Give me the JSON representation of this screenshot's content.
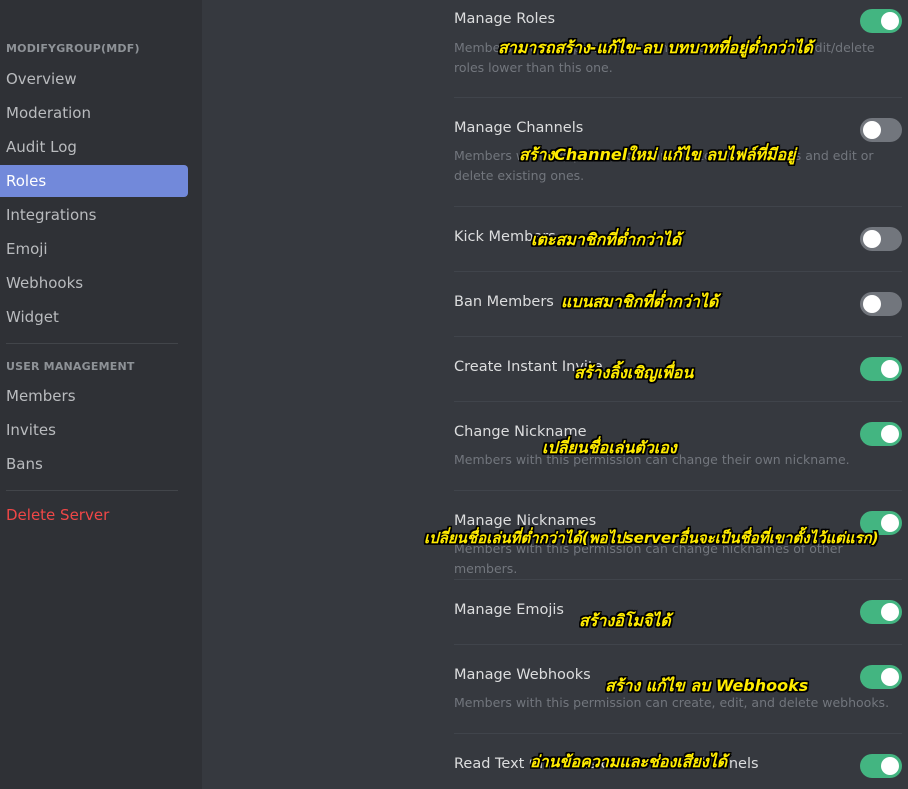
{
  "sidebar": {
    "server_header": "MODIFYGROUP(MDF)",
    "server_items": [
      {
        "label": "Overview"
      },
      {
        "label": "Moderation"
      },
      {
        "label": "Audit Log"
      },
      {
        "label": "Roles"
      },
      {
        "label": "Integrations"
      },
      {
        "label": "Emoji"
      },
      {
        "label": "Webhooks"
      },
      {
        "label": "Widget"
      }
    ],
    "user_header": "USER MANAGEMENT",
    "user_items": [
      {
        "label": "Members"
      },
      {
        "label": "Invites"
      },
      {
        "label": "Bans"
      }
    ],
    "delete_label": "Delete Server",
    "active_item": "Roles"
  },
  "permissions": [
    {
      "title": "Manage Roles",
      "desc": "Members with this permission can create new roles and edit/delete roles lower than this one.",
      "enabled": true,
      "annotation": "สามารถสร้าง-แก้ไข-ลบ บทบาทที่อยู่ต่ำกว่าได้"
    },
    {
      "title": "Manage Channels",
      "desc": "Members with this permission can create new channels and edit or delete existing ones.",
      "enabled": false,
      "annotation": "สร้างChannelใหม่ แก้ไข ลบไฟล์ที่มีอยู่"
    },
    {
      "title": "Kick Members",
      "desc": "",
      "enabled": false,
      "annotation": "เตะสมาชิกที่ต่ำกว่าได้"
    },
    {
      "title": "Ban Members",
      "desc": "",
      "enabled": false,
      "annotation": "แบนสมาชิกที่ต่ำกว่าได้"
    },
    {
      "title": "Create Instant Invite",
      "desc": "",
      "enabled": true,
      "annotation": "สร้างลิ้งเชิญเพื่อน"
    },
    {
      "title": "Change Nickname",
      "desc": "Members with this permission can change their own nickname.",
      "enabled": true,
      "annotation": "เปลี่ยนชื่อเล่นตัวเอง"
    },
    {
      "title": "Manage Nicknames",
      "desc": "Members with this permission can change nicknames of other members.",
      "enabled": true,
      "annotation": "เปลี่ยนชื่อเล่นที่ต่ำกว่าได้(พอไปserverอื่นจะเป็นชื่อที่เขาตั้งไว้แต่แรก)"
    },
    {
      "title": "Manage Emojis",
      "desc": "",
      "enabled": true,
      "annotation": "สร้างอิโมจิได้"
    },
    {
      "title": "Manage Webhooks",
      "desc": "Members with this permission can create, edit, and delete webhooks.",
      "enabled": true,
      "annotation": "สร้าง แก้ไข ลบ Webhooks"
    },
    {
      "title": "Read Text Channels & See Voice Channels",
      "desc": "",
      "enabled": true,
      "annotation": "อ่านข้อความและช่องเสียงได้"
    }
  ],
  "colors": {
    "accent": "#7289da",
    "toggle_on": "#43b581",
    "toggle_off": "#72767d",
    "danger": "#f04747",
    "annotation": "#ffeb00"
  }
}
